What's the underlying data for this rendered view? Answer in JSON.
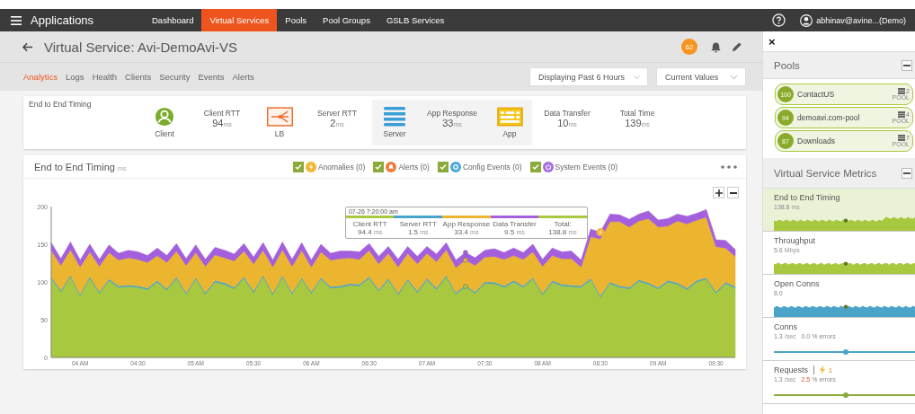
{
  "nav": {
    "title": "Applications",
    "items": [
      {
        "label": "Dashboard",
        "selected": false
      },
      {
        "label": "Virtual Services",
        "selected": true
      },
      {
        "label": "Pools",
        "selected": false
      },
      {
        "label": "Pool Groups",
        "selected": false
      },
      {
        "label": "GSLB Services",
        "selected": false
      }
    ],
    "user": "abhinav@avine...(Demo)"
  },
  "header": {
    "title": "Virtual Service: Avi-DemoAvi-VS",
    "badge": "62"
  },
  "tabs": [
    {
      "label": "Analytics",
      "selected": true
    },
    {
      "label": "Logs",
      "selected": false
    },
    {
      "label": "Health",
      "selected": false
    },
    {
      "label": "Clients",
      "selected": false
    },
    {
      "label": "Security",
      "selected": false
    },
    {
      "label": "Events",
      "selected": false
    },
    {
      "label": "Alerts",
      "selected": false
    }
  ],
  "dropdowns": [
    "Displaying Past 6 Hours",
    "Current Values"
  ],
  "timing": {
    "title": "End to End Timing",
    "items": [
      {
        "kind": "client",
        "label": "Client",
        "highlighted": false
      },
      {
        "kind": "metric",
        "label": "Client RTT",
        "value": "94",
        "unit": "ms",
        "highlighted": false
      },
      {
        "kind": "lb",
        "label": "LB",
        "highlighted": false
      },
      {
        "kind": "metric",
        "label": "Server RTT",
        "value": "2",
        "unit": "ms",
        "highlighted": false
      },
      {
        "kind": "server",
        "label": "Server",
        "highlighted": true
      },
      {
        "kind": "metric",
        "label": "App Response",
        "value": "33",
        "unit": "ms",
        "highlighted": true
      },
      {
        "kind": "app",
        "label": "App",
        "highlighted": true
      },
      {
        "kind": "metric",
        "label": "Data Transfer",
        "value": "10",
        "unit": "ms",
        "highlighted": false
      },
      {
        "kind": "metric",
        "label": "Total Time",
        "value": "139",
        "unit": "ms",
        "highlighted": false
      }
    ]
  },
  "chart_panel": {
    "title": "End to End Timing",
    "unit": "ms",
    "filters": [
      {
        "label": "Anomalies (0)",
        "checked": true,
        "kind": "anomaly",
        "color": "#f2b632"
      },
      {
        "label": "Alerts (0)",
        "checked": true,
        "kind": "alert",
        "color": "#f07c3e"
      },
      {
        "label": "Config Events (0)",
        "checked": true,
        "kind": "config",
        "color": "#4aa8d8"
      },
      {
        "label": "System Events (0)",
        "checked": true,
        "kind": "system",
        "color": "#a569e0"
      }
    ],
    "tooltip": {
      "date": "07-26 7:20:00 am",
      "columns": [
        {
          "label": "Client RTT",
          "value": "94.4",
          "unit": "ms",
          "color": "#a8c840"
        },
        {
          "label": "Server RTT",
          "value": "1.5",
          "unit": "ms",
          "color": "#4aa3c8"
        },
        {
          "label": "App Response",
          "value": "33.4",
          "unit": "ms",
          "color": "#ebb530"
        },
        {
          "label": "Data Transfer",
          "value": "9.5",
          "unit": "ms",
          "color": "#a35fdc"
        },
        {
          "label": "Total:",
          "value": "138.8",
          "unit": "ms",
          "color": "#a8c840"
        }
      ]
    },
    "chart_data": {
      "type": "area",
      "stacked": true,
      "ylim": [
        0,
        200
      ],
      "yticks": [
        0,
        50,
        100,
        150,
        200
      ],
      "categories": [
        null,
        null,
        null,
        "04 AM",
        null,
        null,
        null,
        null,
        null,
        "04:30",
        null,
        null,
        null,
        null,
        null,
        "05 AM",
        null,
        null,
        null,
        null,
        null,
        "05:30",
        null,
        null,
        null,
        null,
        null,
        "06 AM",
        null,
        null,
        null,
        null,
        null,
        "06:30",
        null,
        null,
        null,
        null,
        null,
        "07 AM",
        null,
        null,
        null,
        null,
        null,
        "07:30",
        null,
        null,
        null,
        null,
        null,
        "08 AM",
        null,
        null,
        null,
        null,
        null,
        "08:30",
        null,
        null,
        null,
        null,
        null,
        "09 AM",
        null,
        null,
        null,
        null,
        null,
        "09:30",
        null,
        null
      ],
      "series": [
        {
          "color": "#a8c840",
          "values": [
            105,
            87,
            107,
            82,
            105,
            85,
            102,
            93,
            94,
            93,
            90,
            100,
            89,
            105,
            84,
            104,
            84,
            100,
            97,
            91,
            105,
            86,
            107,
            83,
            107,
            84,
            104,
            85,
            104,
            92,
            93,
            96,
            95,
            105,
            88,
            103,
            83,
            102,
            86,
            103,
            90,
            107,
            84,
            94,
            85,
            98,
            98,
            93,
            100,
            93,
            104,
            83,
            100,
            95,
            94,
            93,
            103,
            80,
            98,
            93,
            91,
            101,
            97,
            91,
            100,
            97,
            90,
            100,
            104,
            85,
            98,
            92
          ]
        },
        {
          "color": "#4aa3c8",
          "values": [
            2,
            2,
            2,
            2,
            2,
            2,
            2,
            2,
            2,
            2,
            2,
            2,
            2,
            2,
            2,
            2,
            2,
            2,
            2,
            2,
            2,
            2,
            2,
            2,
            2,
            2,
            2,
            2,
            2,
            2,
            2,
            2,
            2,
            2,
            2,
            2,
            2,
            2,
            2,
            2,
            2,
            2,
            2,
            2,
            2,
            2,
            2,
            2,
            2,
            2,
            2,
            2,
            2,
            2,
            2,
            2,
            2,
            2,
            2,
            2,
            2,
            2,
            2,
            2,
            2,
            2,
            2,
            2,
            2,
            2,
            2,
            2
          ]
        },
        {
          "color": "#ebb530",
          "values": [
            35,
            33,
            34,
            36,
            33,
            34,
            35,
            34,
            36,
            35,
            34,
            33,
            35,
            34,
            36,
            33,
            35,
            34,
            33,
            35,
            34,
            36,
            33,
            35,
            34,
            35,
            36,
            33,
            34,
            35,
            36,
            34,
            33,
            35,
            34,
            33,
            35,
            34,
            36,
            33,
            35,
            34,
            33,
            33,
            35,
            33,
            34,
            35,
            33,
            35,
            34,
            36,
            33,
            34,
            35,
            25,
            55,
            75,
            80,
            85,
            80,
            78,
            85,
            80,
            72,
            82,
            85,
            80,
            80,
            60,
            45,
            40
          ]
        },
        {
          "color": "#a35fdc",
          "values": [
            10,
            9,
            10,
            9,
            10,
            9,
            10,
            9,
            10,
            10,
            9,
            10,
            9,
            10,
            9,
            10,
            9,
            10,
            10,
            9,
            10,
            9,
            10,
            9,
            10,
            9,
            10,
            9,
            10,
            9,
            10,
            9,
            10,
            9,
            10,
            9,
            10,
            9,
            10,
            9,
            10,
            9,
            10,
            10,
            10,
            9,
            10,
            9,
            10,
            9,
            10,
            9,
            10,
            9,
            10,
            9,
            10,
            9,
            10,
            9,
            10,
            9,
            10,
            9,
            10,
            9,
            10,
            9,
            10,
            9,
            10,
            9
          ]
        }
      ]
    }
  },
  "sidebar": {
    "close": "×",
    "pools": {
      "title": "Pools",
      "items": [
        {
          "score": "100",
          "name": "ContactUS",
          "count": "2",
          "type": "POOL"
        },
        {
          "score": "94",
          "name": "demoavi.com-pool",
          "count": "4",
          "type": "POOL"
        },
        {
          "score": "87",
          "name": "Downloads",
          "count": "7",
          "type": "POOL"
        }
      ]
    },
    "metrics_title": "Virtual Service Metrics",
    "metrics": [
      {
        "name": "End to End Timing",
        "value": "138.8",
        "unit": "ms",
        "kind": "area",
        "color": "#a8c840",
        "selected": true
      },
      {
        "name": "Throughput",
        "value": "5.6",
        "unit": "Mbps",
        "kind": "area",
        "color": "#a8c840",
        "selected": false
      },
      {
        "name": "Open Conns",
        "value": "8.0",
        "kind": "area",
        "color": "#4aa3c8",
        "selected": false
      },
      {
        "name": "Conns",
        "value": "1.3",
        "unit": "/sec",
        "errors": "0.0",
        "errors_unit": "% errors",
        "errors_alert": false,
        "kind": "line",
        "color": "#4aa3c8",
        "selected": false
      },
      {
        "name": "Requests",
        "value": "1.3",
        "unit": "/sec",
        "errors": "2.5",
        "errors_unit": "% errors",
        "errors_alert": true,
        "anomalies": "1",
        "kind": "line",
        "color": "#8aaa3a",
        "selected": false
      }
    ]
  }
}
